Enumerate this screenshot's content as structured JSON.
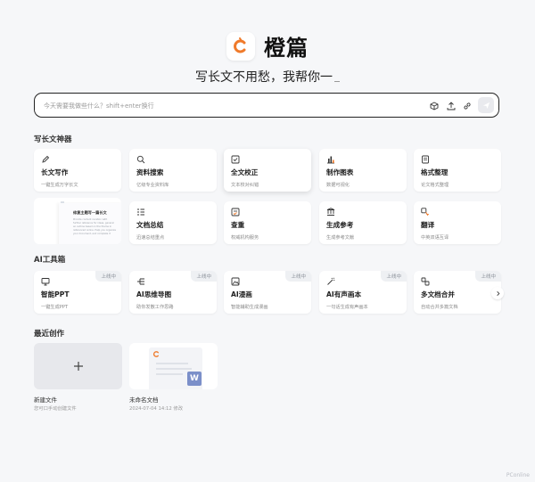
{
  "brand": {
    "name": "橙篇",
    "slogan": "写长文不用愁，我帮你一"
  },
  "search": {
    "placeholder": "今天需要我做些什么？shift+enter换行"
  },
  "sections": {
    "writing": "写长文神器",
    "ai_tools": "AI工具箱",
    "recent": "最近创作"
  },
  "writing_tools": [
    {
      "title": "长文写作",
      "sub": "一键生成万字长文"
    },
    {
      "title": "资料搜索",
      "sub": "亿级专业资料库"
    },
    {
      "title": "全文校正",
      "sub": "文本校对纠错"
    },
    {
      "title": "制作图表",
      "sub": "数据可视化"
    },
    {
      "title": "格式整理",
      "sub": "论文格式整理"
    },
    {
      "title": "文档总结",
      "sub": "迅速总结重点"
    },
    {
      "title": "查重",
      "sub": "权威机构服务"
    },
    {
      "title": "生成参考",
      "sub": "生成参考文献"
    },
    {
      "title": "翻译",
      "sub": "中英双语互译"
    }
  ],
  "ai_tools": [
    {
      "title": "智能PPT",
      "sub": "一键生成PPT",
      "badge": "上线中"
    },
    {
      "title": "AI思维导图",
      "sub": "助你发散工作思路",
      "badge": "上线中"
    },
    {
      "title": "AI漫画",
      "sub": "智能辅助生成漫画",
      "badge": "上线中"
    },
    {
      "title": "AI有声画本",
      "sub": "一句话生成有声画本",
      "badge": "上线中"
    },
    {
      "title": "多文档合并",
      "sub": "自动合并多篇文档",
      "badge": "上线中"
    }
  ],
  "preview": {
    "heading": "修复主题写一篇长文",
    "lines": [
      "Provide content curation with",
      "further reference for ideas, general",
      "an outline based on the theme in",
      "referenced online. Help you organize",
      "your document, and complete it"
    ]
  },
  "recent": {
    "new_title": "新建文件",
    "new_sub": "您可口手动创建文件",
    "doc_title": "未命名文档",
    "doc_date": "2024-07-04 14:12 修改"
  },
  "watermark": "PConline",
  "colors": {
    "accent": "#f07a2a",
    "brand_dark": "#1a1a1a"
  }
}
